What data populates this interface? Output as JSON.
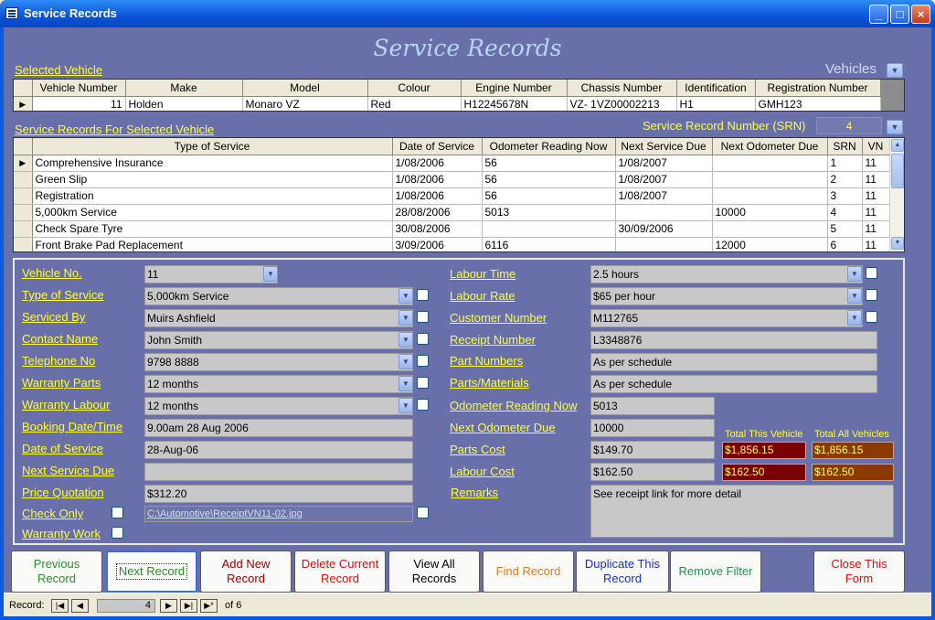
{
  "window": {
    "title": "Service Records"
  },
  "form": {
    "title": "Service Records"
  },
  "vehicle_section": {
    "label": "Selected Vehicle",
    "vehicles_label": "Vehicles",
    "columns": [
      "Vehicle Number",
      "Make",
      "Model",
      "Colour",
      "Engine Number",
      "Chassis Number",
      "Identification",
      "Registration Number"
    ],
    "row": [
      "11",
      "Holden",
      "Monaro VZ",
      "Red",
      "H12245678N",
      "VZ- 1VZ00002213",
      "H1",
      "GMH123"
    ]
  },
  "records_section": {
    "label": "Service Records For Selected Vehicle",
    "srn_label": "Service Record Number (SRN)",
    "srn_value": "4",
    "columns": [
      "Type of Service",
      "Date of Service",
      "Odometer Reading Now",
      "Next Service Due",
      "Next Odometer Due",
      "SRN",
      "VN"
    ],
    "rows": [
      [
        "Comprehensive Insurance",
        "1/08/2006",
        "56",
        "1/08/2007",
        "",
        "1",
        "11"
      ],
      [
        "Green Slip",
        "1/08/2006",
        "56",
        "1/08/2007",
        "",
        "2",
        "11"
      ],
      [
        "Registration",
        "1/08/2006",
        "56",
        "1/08/2007",
        "",
        "3",
        "11"
      ],
      [
        "5,000km Service",
        "28/08/2006",
        "5013",
        "",
        "10000",
        "4",
        "11"
      ],
      [
        "Check Spare Tyre",
        "30/08/2006",
        "",
        "30/09/2006",
        "",
        "5",
        "11"
      ],
      [
        "Front Brake Pad Replacement",
        "3/09/2006",
        "6116",
        "",
        "12000",
        "6",
        "11"
      ]
    ]
  },
  "detail": {
    "vehicle_no": {
      "label": "Vehicle No.",
      "value": "11"
    },
    "type_of_service": {
      "label": "Type of Service",
      "value": "5,000km Service"
    },
    "serviced_by": {
      "label": "Serviced By",
      "value": "Muirs Ashfield"
    },
    "contact_name": {
      "label": "Contact Name",
      "value": "John Smith"
    },
    "telephone": {
      "label": "Telephone No",
      "value": "9798 8888"
    },
    "warranty_parts": {
      "label": "Warranty Parts",
      "value": "12 months"
    },
    "warranty_labour": {
      "label": "Warranty Labour",
      "value": "12 months"
    },
    "booking": {
      "label": "Booking Date/Time",
      "value": "9.00am 28 Aug 2006"
    },
    "date_of_service": {
      "label": "Date of Service",
      "value": "28-Aug-06"
    },
    "next_service_due": {
      "label": "Next Service Due",
      "value": ""
    },
    "price_quotation": {
      "label": "Price Quotation",
      "value": "$312.20"
    },
    "check_only": {
      "label": "Check Only",
      "link": "C:\\Automotive\\ReceiptVN11-02.jpg"
    },
    "warranty_work": {
      "label": "Warranty Work"
    },
    "labour_time": {
      "label": "Labour Time",
      "value": "2.5 hours"
    },
    "labour_rate": {
      "label": "Labour Rate",
      "value": "$65 per hour"
    },
    "customer_number": {
      "label": "Customer Number",
      "value": "M112765"
    },
    "receipt_number": {
      "label": "Receipt Number",
      "value": "L3348876"
    },
    "part_numbers": {
      "label": "Part Numbers",
      "value": "As per schedule"
    },
    "parts_materials": {
      "label": "Parts/Materials",
      "value": "As per schedule"
    },
    "odometer_now": {
      "label": "Odometer Reading Now",
      "value": "5013"
    },
    "next_odometer": {
      "label": "Next Odometer Due",
      "value": "10000"
    },
    "parts_cost": {
      "label": "Parts Cost",
      "value": "$149.70"
    },
    "labour_cost": {
      "label": "Labour Cost",
      "value": "$162.50"
    },
    "remarks": {
      "label": "Remarks",
      "value": "See receipt link for more detail"
    },
    "totals": {
      "vehicle_label": "Total This Vehicle",
      "all_label": "Total All Vehicles",
      "parts_vehicle": "$1,856.15",
      "parts_all": "$1,856.15",
      "labour_vehicle": "$162.50",
      "labour_all": "$162.50"
    }
  },
  "buttons": {
    "previous": "Previous Record",
    "next": "Next Record",
    "add": "Add New Record",
    "delete": "Delete Current Record",
    "view_all": "View All Records",
    "find": "Find Record",
    "duplicate": "Duplicate This Record",
    "remove_filter": "Remove Filter",
    "close": "Close This Form"
  },
  "navigation": {
    "record_label": "Record:",
    "current": "4",
    "of_text": "of 6"
  },
  "colors": {
    "label_yellow": "#FFFF33",
    "form_bg": "#696FA8",
    "total_dark": "#7A0000",
    "total_orange": "#8A3A00"
  }
}
